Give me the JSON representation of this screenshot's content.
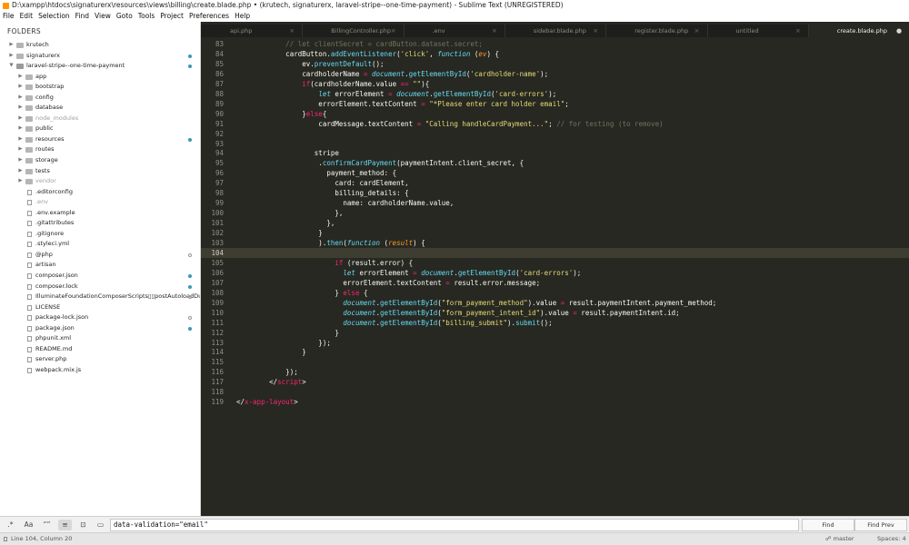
{
  "window": {
    "title": "D:\\xampp\\htdocs\\signaturerx\\resources\\views\\billing\\create.blade.php • (krutech, signaturerx, laravel-stripe--one-time-payment) - Sublime Text (UNREGISTERED)"
  },
  "menu": [
    "File",
    "Edit",
    "Selection",
    "Find",
    "View",
    "Goto",
    "Tools",
    "Project",
    "Preferences",
    "Help"
  ],
  "sidebar": {
    "heading": "FOLDERS",
    "items": [
      {
        "label": "krutech",
        "type": "folder",
        "open": false,
        "depth": 0,
        "dim": false,
        "marker": "none"
      },
      {
        "label": "signaturerx",
        "type": "folder",
        "open": false,
        "depth": 0,
        "dim": false,
        "marker": "dot"
      },
      {
        "label": "laravel-stripe--one-time-payment",
        "type": "folder",
        "open": true,
        "depth": 0,
        "dim": false,
        "marker": "dot"
      },
      {
        "label": "app",
        "type": "folder",
        "open": false,
        "depth": 1,
        "dim": false,
        "marker": "none"
      },
      {
        "label": "bootstrap",
        "type": "folder",
        "open": false,
        "depth": 1,
        "dim": false,
        "marker": "none"
      },
      {
        "label": "config",
        "type": "folder",
        "open": false,
        "depth": 1,
        "dim": false,
        "marker": "none"
      },
      {
        "label": "database",
        "type": "folder",
        "open": false,
        "depth": 1,
        "dim": false,
        "marker": "none"
      },
      {
        "label": "node_modules",
        "type": "folder",
        "open": false,
        "depth": 1,
        "dim": true,
        "marker": "none"
      },
      {
        "label": "public",
        "type": "folder",
        "open": false,
        "depth": 1,
        "dim": false,
        "marker": "none"
      },
      {
        "label": "resources",
        "type": "folder",
        "open": false,
        "depth": 1,
        "dim": false,
        "marker": "dot"
      },
      {
        "label": "routes",
        "type": "folder",
        "open": false,
        "depth": 1,
        "dim": false,
        "marker": "none"
      },
      {
        "label": "storage",
        "type": "folder",
        "open": false,
        "depth": 1,
        "dim": false,
        "marker": "none"
      },
      {
        "label": "tests",
        "type": "folder",
        "open": false,
        "depth": 1,
        "dim": false,
        "marker": "none"
      },
      {
        "label": "vendor",
        "type": "folder",
        "open": false,
        "depth": 1,
        "dim": true,
        "marker": "none"
      },
      {
        "label": ".editorconfig",
        "type": "file",
        "depth": 1,
        "dim": false,
        "marker": "none"
      },
      {
        "label": ".env",
        "type": "file",
        "depth": 1,
        "dim": true,
        "marker": "none"
      },
      {
        "label": ".env.example",
        "type": "file",
        "depth": 1,
        "dim": false,
        "marker": "none"
      },
      {
        "label": ".gitattributes",
        "type": "file",
        "depth": 1,
        "dim": false,
        "marker": "none"
      },
      {
        "label": ".gitignore",
        "type": "file",
        "depth": 1,
        "dim": false,
        "marker": "none"
      },
      {
        "label": ".styleci.yml",
        "type": "file",
        "depth": 1,
        "dim": false,
        "marker": "none"
      },
      {
        "label": "@php",
        "type": "file",
        "depth": 1,
        "dim": false,
        "marker": "ring"
      },
      {
        "label": "artisan",
        "type": "file",
        "depth": 1,
        "dim": false,
        "marker": "none"
      },
      {
        "label": "composer.json",
        "type": "file",
        "depth": 1,
        "dim": false,
        "marker": "dot"
      },
      {
        "label": "composer.lock",
        "type": "file",
        "depth": 1,
        "dim": false,
        "marker": "dot"
      },
      {
        "label": "IlluminateFoundationComposerScripts▯▯postAutoloadDu",
        "type": "file",
        "depth": 1,
        "dim": false,
        "marker": "ring"
      },
      {
        "label": "LICENSE",
        "type": "file",
        "depth": 1,
        "dim": false,
        "marker": "none"
      },
      {
        "label": "package-lock.json",
        "type": "file",
        "depth": 1,
        "dim": false,
        "marker": "ring"
      },
      {
        "label": "package.json",
        "type": "file",
        "depth": 1,
        "dim": false,
        "marker": "dot"
      },
      {
        "label": "phpunit.xml",
        "type": "file",
        "depth": 1,
        "dim": false,
        "marker": "none"
      },
      {
        "label": "README.md",
        "type": "file",
        "depth": 1,
        "dim": false,
        "marker": "none"
      },
      {
        "label": "server.php",
        "type": "file",
        "depth": 1,
        "dim": false,
        "marker": "none"
      },
      {
        "label": "webpack.mix.js",
        "type": "file",
        "depth": 1,
        "dim": false,
        "marker": "none"
      }
    ]
  },
  "tabs": [
    {
      "label": "api.php",
      "active": false
    },
    {
      "label": "BillingController.php",
      "active": false
    },
    {
      "label": ".env",
      "active": false
    },
    {
      "label": "sidebar.blade.php",
      "active": false
    },
    {
      "label": "register.blade.php",
      "active": false
    },
    {
      "label": "untitled",
      "active": false
    },
    {
      "label": "create.blade.php",
      "active": true
    }
  ],
  "editor": {
    "current_line": 104,
    "lines": [
      {
        "n": 83,
        "tokens": [
          [
            "cm",
            "            // let clientSecret = cardButton.dataset.secret;"
          ]
        ]
      },
      {
        "n": 84,
        "tokens": [
          [
            "",
            "            cardButton."
          ],
          [
            "fn",
            "addEventListener"
          ],
          [
            "",
            "("
          ],
          [
            "str",
            "'click'"
          ],
          [
            "",
            ", "
          ],
          [
            "it",
            "function"
          ],
          [
            "",
            " ("
          ],
          [
            "param",
            "ev"
          ],
          [
            "",
            ") {"
          ]
        ]
      },
      {
        "n": 85,
        "tokens": [
          [
            "",
            "                ev."
          ],
          [
            "fn",
            "preventDefault"
          ],
          [
            "",
            "();"
          ]
        ]
      },
      {
        "n": 86,
        "tokens": [
          [
            "",
            "                cardholderName "
          ],
          [
            "op",
            "="
          ],
          [
            "",
            " "
          ],
          [
            "var",
            "document"
          ],
          [
            "",
            "."
          ],
          [
            "fn",
            "getElementById"
          ],
          [
            "",
            "("
          ],
          [
            "str",
            "'cardholder-name'"
          ],
          [
            "",
            ");"
          ]
        ]
      },
      {
        "n": 87,
        "tokens": [
          [
            "",
            "                "
          ],
          [
            "kw",
            "if"
          ],
          [
            "",
            "(cardholderName.value "
          ],
          [
            "op",
            "=="
          ],
          [
            "",
            " "
          ],
          [
            "str",
            "\"\""
          ],
          [
            "",
            "){"
          ]
        ]
      },
      {
        "n": 88,
        "tokens": [
          [
            "",
            "                    "
          ],
          [
            "it",
            "let"
          ],
          [
            "",
            " errorElement "
          ],
          [
            "op",
            "="
          ],
          [
            "",
            " "
          ],
          [
            "var",
            "document"
          ],
          [
            "",
            "."
          ],
          [
            "fn",
            "getElementById"
          ],
          [
            "",
            "("
          ],
          [
            "str",
            "'card-errors'"
          ],
          [
            "",
            ");"
          ]
        ]
      },
      {
        "n": 89,
        "tokens": [
          [
            "",
            "                    errorElement.textContent "
          ],
          [
            "op",
            "="
          ],
          [
            "",
            " "
          ],
          [
            "str",
            "\"*Please enter card holder email\""
          ],
          [
            "",
            ";"
          ]
        ]
      },
      {
        "n": 90,
        "tokens": [
          [
            "",
            "                }"
          ],
          [
            "kw",
            "else"
          ],
          [
            "",
            "{"
          ]
        ]
      },
      {
        "n": 91,
        "tokens": [
          [
            "",
            "                    cardMessage.textContent "
          ],
          [
            "op",
            "="
          ],
          [
            "",
            " "
          ],
          [
            "str",
            "\"Calling handleCardPayment...\""
          ],
          [
            "",
            "; "
          ],
          [
            "cm",
            "// for testing (to remove)"
          ]
        ]
      },
      {
        "n": 92,
        "tokens": []
      },
      {
        "n": 93,
        "tokens": []
      },
      {
        "n": 94,
        "tokens": [
          [
            "",
            "                   stripe"
          ]
        ]
      },
      {
        "n": 95,
        "tokens": [
          [
            "",
            "                    ."
          ],
          [
            "fn",
            "confirmCardPayment"
          ],
          [
            "",
            "(paymentIntent.client_secret, {"
          ]
        ]
      },
      {
        "n": 96,
        "tokens": [
          [
            "",
            "                      payment_method: {"
          ]
        ]
      },
      {
        "n": 97,
        "tokens": [
          [
            "",
            "                        card: cardElement,"
          ]
        ]
      },
      {
        "n": 98,
        "tokens": [
          [
            "",
            "                        billing_details: {"
          ]
        ]
      },
      {
        "n": 99,
        "tokens": [
          [
            "",
            "                          name: cardholderName.value,"
          ]
        ]
      },
      {
        "n": 100,
        "tokens": [
          [
            "",
            "                        },"
          ]
        ]
      },
      {
        "n": 101,
        "tokens": [
          [
            "",
            "                      },"
          ]
        ]
      },
      {
        "n": 102,
        "tokens": [
          [
            "",
            "                    }"
          ]
        ]
      },
      {
        "n": 103,
        "tokens": [
          [
            "",
            "                    )."
          ],
          [
            "fn",
            "then"
          ],
          [
            "",
            "("
          ],
          [
            "it",
            "function"
          ],
          [
            "",
            " ("
          ],
          [
            "param",
            "result"
          ],
          [
            "",
            ") {"
          ]
        ]
      },
      {
        "n": 104,
        "tokens": []
      },
      {
        "n": 105,
        "tokens": [
          [
            "",
            "                        "
          ],
          [
            "kw",
            "if"
          ],
          [
            "",
            " (result.error) {"
          ]
        ]
      },
      {
        "n": 106,
        "tokens": [
          [
            "",
            "                          "
          ],
          [
            "it",
            "let"
          ],
          [
            "",
            " errorElement "
          ],
          [
            "op",
            "="
          ],
          [
            "",
            " "
          ],
          [
            "var",
            "document"
          ],
          [
            "",
            "."
          ],
          [
            "fn",
            "getElementById"
          ],
          [
            "",
            "("
          ],
          [
            "str",
            "'card-errors'"
          ],
          [
            "",
            ");"
          ]
        ]
      },
      {
        "n": 107,
        "tokens": [
          [
            "",
            "                          errorElement.textContent "
          ],
          [
            "op",
            "="
          ],
          [
            "",
            " result.error.message;"
          ]
        ]
      },
      {
        "n": 108,
        "tokens": [
          [
            "",
            "                        } "
          ],
          [
            "kw",
            "else"
          ],
          [
            "",
            " {"
          ]
        ]
      },
      {
        "n": 109,
        "tokens": [
          [
            "",
            "                          "
          ],
          [
            "var",
            "document"
          ],
          [
            "",
            "."
          ],
          [
            "fn",
            "getElementById"
          ],
          [
            "",
            "("
          ],
          [
            "str",
            "\"form_payment_method\""
          ],
          [
            "",
            ").value "
          ],
          [
            "op",
            "="
          ],
          [
            "",
            " result.paymentIntent.payment_method;"
          ]
        ]
      },
      {
        "n": 110,
        "tokens": [
          [
            "",
            "                          "
          ],
          [
            "var",
            "document"
          ],
          [
            "",
            "."
          ],
          [
            "fn",
            "getElementById"
          ],
          [
            "",
            "("
          ],
          [
            "str",
            "\"form_payment_intent_id\""
          ],
          [
            "",
            ").value "
          ],
          [
            "op",
            "="
          ],
          [
            "",
            " result.paymentIntent.id;"
          ]
        ]
      },
      {
        "n": 111,
        "tokens": [
          [
            "",
            "                          "
          ],
          [
            "var",
            "document"
          ],
          [
            "",
            "."
          ],
          [
            "fn",
            "getElementById"
          ],
          [
            "",
            "("
          ],
          [
            "str",
            "\"billing_submit\""
          ],
          [
            "",
            ")."
          ],
          [
            "fn",
            "submit"
          ],
          [
            "",
            "();"
          ]
        ]
      },
      {
        "n": 112,
        "tokens": [
          [
            "",
            "                        }"
          ]
        ]
      },
      {
        "n": 113,
        "tokens": [
          [
            "",
            "                    });"
          ]
        ]
      },
      {
        "n": 114,
        "tokens": [
          [
            "",
            "                }"
          ]
        ]
      },
      {
        "n": 115,
        "tokens": []
      },
      {
        "n": 116,
        "tokens": [
          [
            "",
            "            });"
          ]
        ]
      },
      {
        "n": 117,
        "tokens": [
          [
            "",
            "        </"
          ],
          [
            "tag",
            "script"
          ],
          [
            "",
            ">"
          ]
        ]
      },
      {
        "n": 118,
        "tokens": []
      },
      {
        "n": 119,
        "tokens": [
          [
            "",
            "</"
          ],
          [
            "tag",
            "x-app-layout"
          ],
          [
            "",
            ">"
          ]
        ]
      }
    ]
  },
  "findbar": {
    "toggles": [
      ".*",
      "Aa",
      "“”",
      "≡",
      "⊡",
      "▭"
    ],
    "query": "data-validation=\"email\"",
    "find_label": "Find",
    "find_prev_label": "Find Prev"
  },
  "status": {
    "position": "Line 104, Column 20",
    "branch": "master",
    "indent": "Spaces: 4"
  }
}
